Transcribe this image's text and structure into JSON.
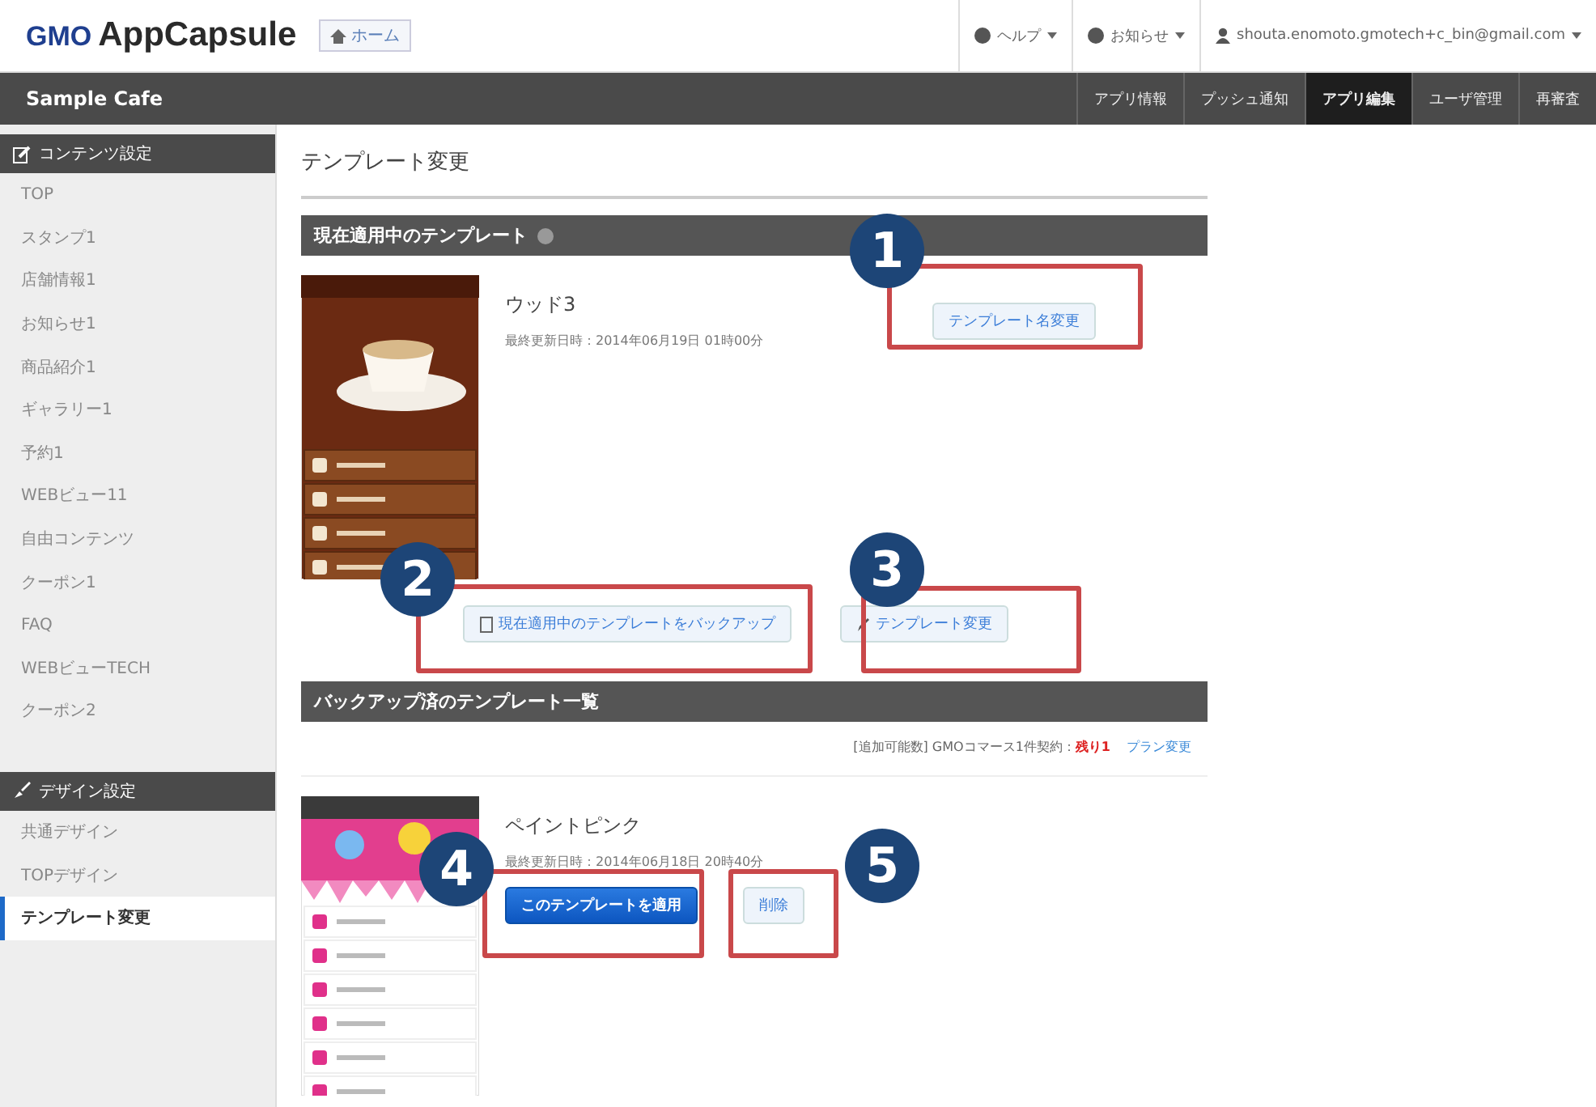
{
  "header": {
    "logo_brand": "GMO",
    "logo_product": "AppCapsule",
    "home_button": "ホーム",
    "help_menu": "ヘルプ",
    "notice_menu": "お知らせ",
    "account": "shouta.enomoto.gmotech+c_bin@gmail.com"
  },
  "navbar": {
    "app_name": "Sample Cafe",
    "tabs": [
      {
        "label": "アプリ情報",
        "selected": false
      },
      {
        "label": "プッシュ通知",
        "selected": false
      },
      {
        "label": "アプリ編集",
        "selected": true
      },
      {
        "label": "ユーザ管理",
        "selected": false
      },
      {
        "label": "再審査",
        "selected": false
      }
    ]
  },
  "sidebar": {
    "sections": [
      {
        "title": "コンテンツ設定",
        "kind": "content",
        "items": [
          {
            "label": "TOP",
            "selected": false
          },
          {
            "label": "スタンプ1",
            "selected": false
          },
          {
            "label": "店舗情報1",
            "selected": false
          },
          {
            "label": "お知らせ1",
            "selected": false
          },
          {
            "label": "商品紹介1",
            "selected": false
          },
          {
            "label": "ギャラリー1",
            "selected": false
          },
          {
            "label": "予約1",
            "selected": false
          },
          {
            "label": "WEBビュー11",
            "selected": false
          },
          {
            "label": "自由コンテンツ",
            "selected": false
          },
          {
            "label": "クーポン1",
            "selected": false
          },
          {
            "label": "FAQ",
            "selected": false
          },
          {
            "label": "WEBビューTECH",
            "selected": false
          },
          {
            "label": "クーポン2",
            "selected": false
          }
        ]
      },
      {
        "title": "デザイン設定",
        "kind": "design",
        "items": [
          {
            "label": "共通デザイン",
            "selected": false
          },
          {
            "label": "TOPデザイン",
            "selected": false
          },
          {
            "label": "テンプレート変更",
            "selected": true
          }
        ]
      }
    ]
  },
  "page_title": "テンプレート変更",
  "current": {
    "heading": "現在適用中のテンプレート",
    "name": "ウッド3",
    "updated": "最終更新日時：2014年06月19日 01時00分",
    "rename_button": "テンプレート名変更",
    "buttons": [
      {
        "label": "現在適用中のテンプレートをバックアップ",
        "kind": "backup"
      },
      {
        "label": "テンプレート変更",
        "kind": "change"
      }
    ]
  },
  "backups": {
    "heading": "バックアップ済のテンプレート一覧",
    "quota_label": "[追加可能数] GMOコマース1件契約：",
    "quota_remaining": "残り1",
    "plan_link": "プラン変更",
    "templates": [
      {
        "name": "ペイントピンク",
        "updated": "最終更新日時：2014年06月18日 20時40分",
        "buttons": [
          {
            "label": "このテンプレートを適用",
            "kind": "primary"
          },
          {
            "label": "削除",
            "kind": "default"
          }
        ]
      }
    ]
  },
  "callouts": [
    {
      "number": "1"
    },
    {
      "number": "2"
    },
    {
      "number": "3"
    },
    {
      "number": "4"
    },
    {
      "number": "5"
    }
  ]
}
